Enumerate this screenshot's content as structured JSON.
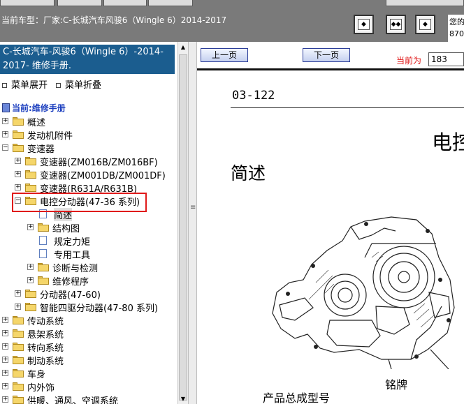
{
  "top_bar": {
    "title": "当前车型：厂家:C-长城汽车风骏6（Wingle 6）2014-2017",
    "right_text_line1": "您的",
    "right_text_line2": "870"
  },
  "left_panel": {
    "book_title": "C-长城汽车-风骏6（Wingle 6）-2014-2017- 维修手册.",
    "expand_label": "菜单展开",
    "collapse_label": "菜单折叠",
    "current_label": "当前:维修手册",
    "tree": [
      {
        "label": "概述",
        "type": "folder",
        "level": 0,
        "toggle": "+"
      },
      {
        "label": "发动机附件",
        "type": "folder",
        "level": 0,
        "toggle": "+"
      },
      {
        "label": "变速器",
        "type": "folder",
        "level": 0,
        "toggle": "-"
      },
      {
        "label": "变速器(ZM016B/ZM016BF)",
        "type": "folder",
        "level": 1,
        "toggle": "+"
      },
      {
        "label": "变速器(ZM001DB/ZM001DF)",
        "type": "folder",
        "level": 1,
        "toggle": "+"
      },
      {
        "label": "变速器(R631A/R631B)",
        "type": "folder",
        "level": 1,
        "toggle": "+"
      },
      {
        "label": "电控分动器(47-36 系列)",
        "type": "folder",
        "level": 1,
        "toggle": "-",
        "highlighted": true
      },
      {
        "label": "简述",
        "type": "page",
        "level": 2,
        "selected": true
      },
      {
        "label": "结构图",
        "type": "folder",
        "level": 2,
        "toggle": "+"
      },
      {
        "label": "规定力矩",
        "type": "page",
        "level": 2
      },
      {
        "label": "专用工具",
        "type": "page",
        "level": 2
      },
      {
        "label": "诊断与检测",
        "type": "folder",
        "level": 2,
        "toggle": "+"
      },
      {
        "label": "维修程序",
        "type": "folder",
        "level": 2,
        "toggle": "+"
      },
      {
        "label": "分动器(47-60)",
        "type": "folder",
        "level": 1,
        "toggle": "+"
      },
      {
        "label": "智能四驱分动器(47-80 系列)",
        "type": "folder",
        "level": 1,
        "toggle": "+"
      },
      {
        "label": "传动系统",
        "type": "folder",
        "level": 0,
        "toggle": "+"
      },
      {
        "label": "悬架系统",
        "type": "folder",
        "level": 0,
        "toggle": "+"
      },
      {
        "label": "转向系统",
        "type": "folder",
        "level": 0,
        "toggle": "+"
      },
      {
        "label": "制动系统",
        "type": "folder",
        "level": 0,
        "toggle": "+"
      },
      {
        "label": "车身",
        "type": "folder",
        "level": 0,
        "toggle": "+"
      },
      {
        "label": "内外饰",
        "type": "folder",
        "level": 0,
        "toggle": "+"
      },
      {
        "label": "供暖、通风、空调系统",
        "type": "folder",
        "level": 0,
        "toggle": "+"
      }
    ]
  },
  "doc_nav": {
    "prev_label": "上一页",
    "next_label": "下一页",
    "current_label": "当前为",
    "page_value": "183"
  },
  "doc_page": {
    "page_number": "03-122",
    "heading": "电控",
    "subheading": "简述",
    "caption_nameplate": "铭牌",
    "caption_model": "产品总成型号"
  },
  "colors": {
    "title_bar_bg": "#7a7a7a",
    "book_title_bg": "#1b5d8f",
    "highlight_border": "#e01a1a",
    "current_link": "#1c3fbf"
  }
}
